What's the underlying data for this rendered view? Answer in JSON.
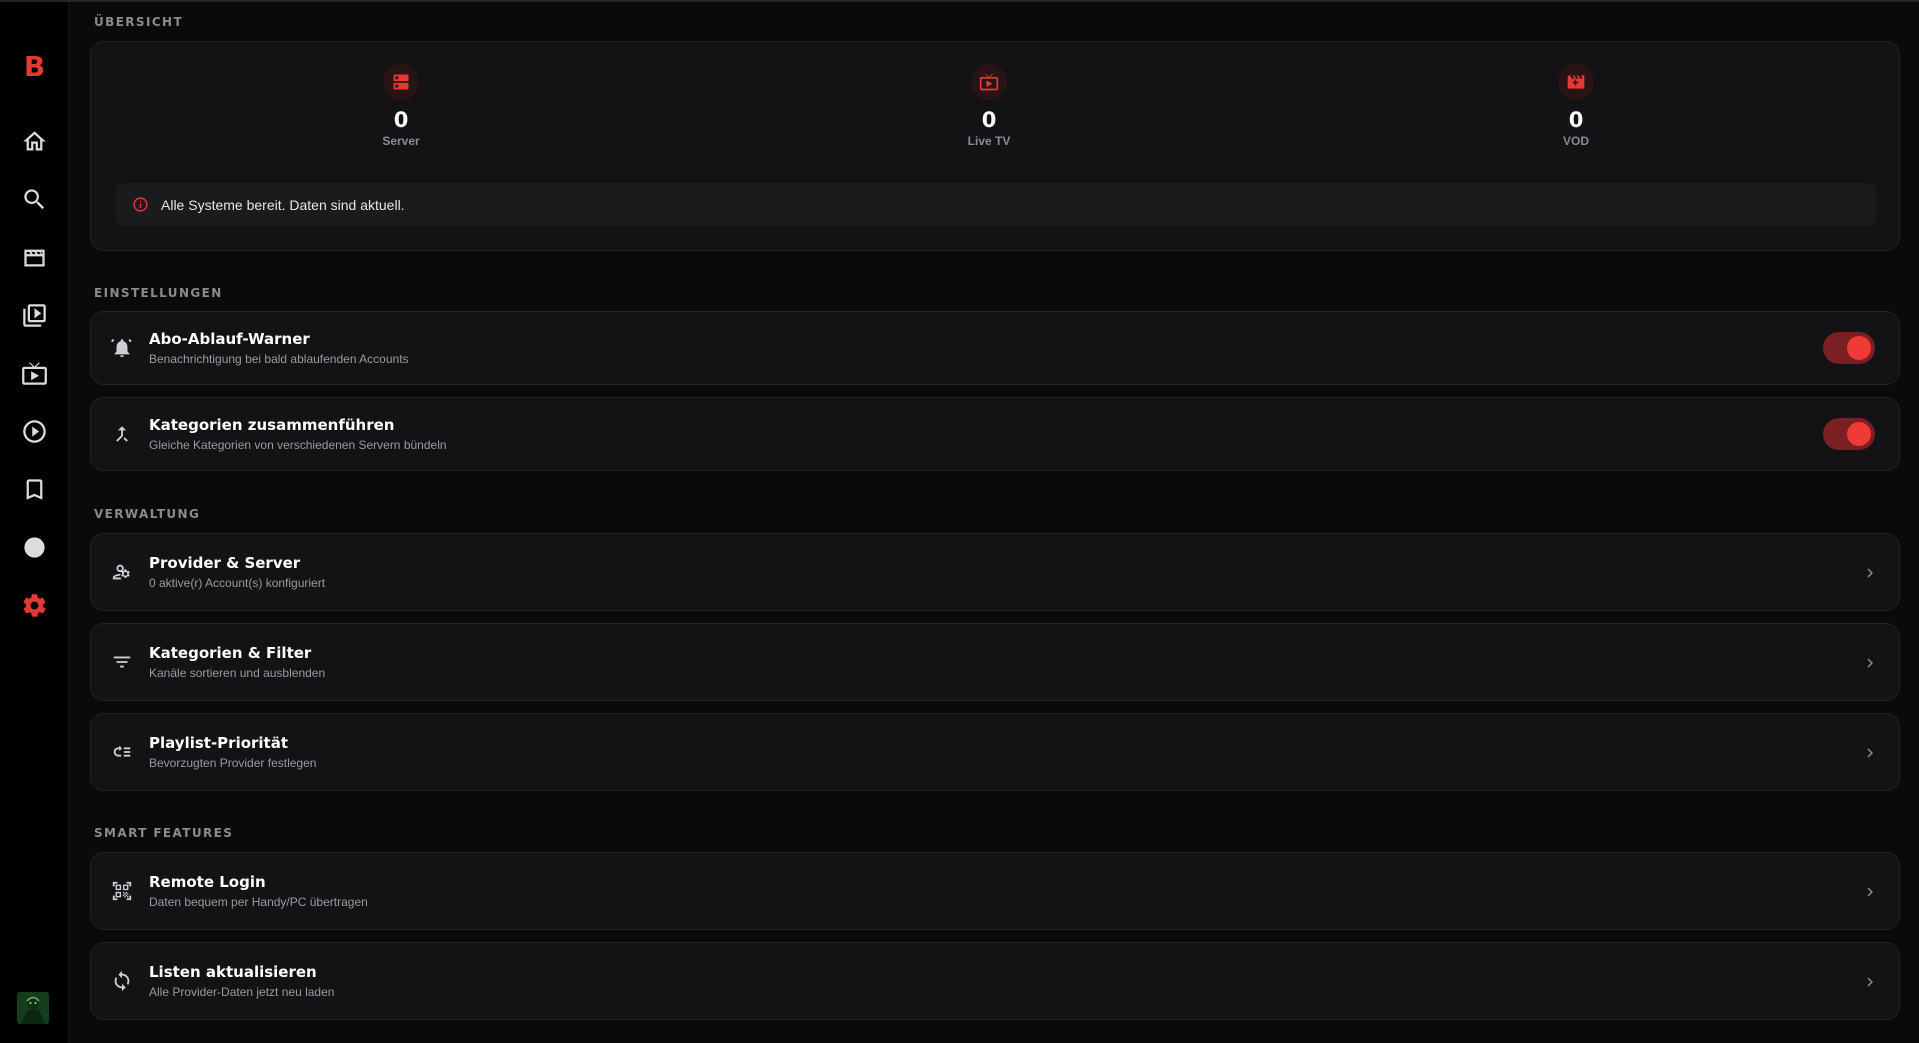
{
  "sidebar": {
    "logo": "B",
    "items": [
      {
        "icon": "home-icon",
        "active": false
      },
      {
        "icon": "search-icon",
        "active": false
      },
      {
        "icon": "movie-icon",
        "active": false
      },
      {
        "icon": "video-library-icon",
        "active": false
      },
      {
        "icon": "live-tv-icon",
        "active": false
      },
      {
        "icon": "play-circle-icon",
        "active": false
      },
      {
        "icon": "bookmark-icon",
        "active": false
      },
      {
        "icon": "circle-icon",
        "active": false
      },
      {
        "icon": "settings-icon",
        "active": true
      }
    ],
    "accent_color": "#e53935"
  },
  "overview": {
    "title": "ÜBERSICHT",
    "stats": [
      {
        "icon": "server-icon",
        "value": "0",
        "label": "Server"
      },
      {
        "icon": "live-tv-icon",
        "value": "0",
        "label": "Live TV"
      },
      {
        "icon": "movie-icon",
        "value": "0",
        "label": "VOD"
      }
    ],
    "status_icon": "info-icon",
    "status": "Alle Systeme bereit. Daten sind aktuell."
  },
  "settings": {
    "title": "EINSTELLUNGEN",
    "items": [
      {
        "icon": "alarm-icon",
        "title": "Abo-Ablauf-Warner",
        "subtitle": "Benachrichtigung bei bald ablaufenden Accounts",
        "enabled": true
      },
      {
        "icon": "merge-icon",
        "title": "Kategorien zusammenführen",
        "subtitle": "Gleiche Kategorien von verschiedenen Servern bündeln",
        "enabled": true
      }
    ]
  },
  "management": {
    "title": "VERWALTUNG",
    "items": [
      {
        "icon": "manage-accounts-icon",
        "title": "Provider & Server",
        "subtitle": "0 aktive(r) Account(s) konfiguriert"
      },
      {
        "icon": "filter-icon",
        "title": "Kategorien & Filter",
        "subtitle": "Kanäle sortieren und ausblenden"
      },
      {
        "icon": "priority-list-icon",
        "title": "Playlist-Priorität",
        "subtitle": "Bevorzugten Provider festlegen"
      }
    ]
  },
  "smart": {
    "title": "SMART FEATURES",
    "items": [
      {
        "icon": "qr-code-scanner-icon",
        "title": "Remote Login",
        "subtitle": "Daten bequem per Handy/PC übertragen"
      },
      {
        "icon": "sync-icon",
        "title": "Listen aktualisieren",
        "subtitle": "Alle Provider-Daten jetzt neu laden"
      }
    ]
  }
}
